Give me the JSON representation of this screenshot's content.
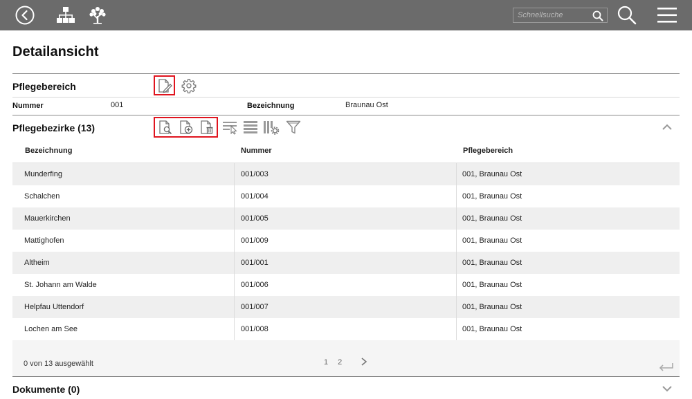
{
  "topbar": {
    "search_placeholder": "Schnellsuche"
  },
  "page": {
    "title": "Detailansicht"
  },
  "pflegebereich": {
    "title": "Pflegebereich",
    "nummer_label": "Nummer",
    "nummer_value": "001",
    "bezeichnung_label": "Bezeichnung",
    "bezeichnung_value": "Braunau Ost"
  },
  "pflegebezirke": {
    "title": "Pflegebezirke (13)",
    "columns": [
      "Bezeichnung",
      "Nummer",
      "Pflegebereich"
    ],
    "rows": [
      [
        "Munderfing",
        "001/003",
        "001, Braunau Ost"
      ],
      [
        "Schalchen",
        "001/004",
        "001, Braunau Ost"
      ],
      [
        "Mauerkirchen",
        "001/005",
        "001, Braunau Ost"
      ],
      [
        "Mattighofen",
        "001/009",
        "001, Braunau Ost"
      ],
      [
        "Altheim",
        "001/001",
        "001, Braunau Ost"
      ],
      [
        "St. Johann am Walde",
        "001/006",
        "001, Braunau Ost"
      ],
      [
        "Helpfau Uttendorf",
        "001/007",
        "001, Braunau Ost"
      ],
      [
        "Lochen am See",
        "001/008",
        "001, Braunau Ost"
      ]
    ],
    "selection": "0 von 13 ausgewählt",
    "pages": [
      "1",
      "2"
    ]
  },
  "dokumente": {
    "title": "Dokumente (0)"
  },
  "colors": {
    "topbar": "#6b6b6b",
    "highlight_frame": "#e0141e",
    "row_stripe": "#efefef"
  },
  "icons": [
    "back-icon",
    "org-chart-icon",
    "tree-icon",
    "search-icon",
    "menu-icon",
    "edit-document-icon",
    "gear-icon",
    "view-document-icon",
    "add-document-icon",
    "delete-document-icon",
    "select-rows-icon",
    "list-view-icon",
    "column-settings-icon",
    "filter-icon",
    "chevron-up-icon",
    "chevron-down-icon",
    "chevron-right-icon",
    "return-icon"
  ]
}
